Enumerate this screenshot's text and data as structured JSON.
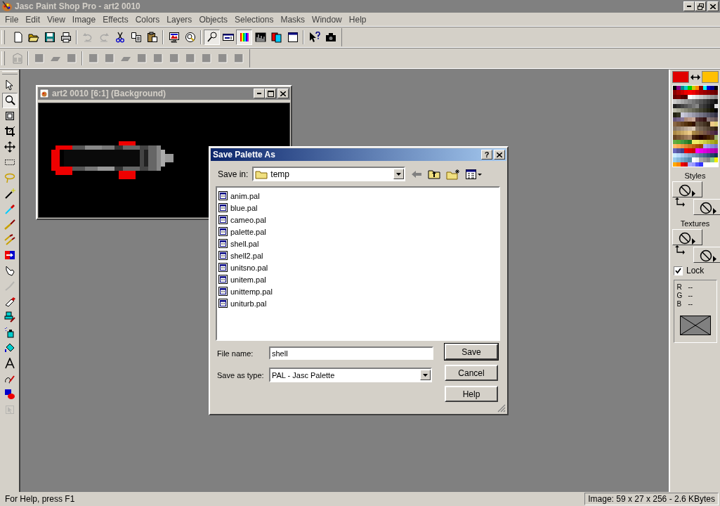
{
  "window": {
    "title": "Jasc Paint Shop Pro - art2 0010"
  },
  "menu": [
    "File",
    "Edit",
    "View",
    "Image",
    "Effects",
    "Colors",
    "Layers",
    "Objects",
    "Selections",
    "Masks",
    "Window",
    "Help"
  ],
  "toolbar_standard": [
    {
      "kind": "new",
      "pressed": false,
      "disabled": false
    },
    {
      "kind": "open",
      "pressed": false,
      "disabled": false
    },
    {
      "kind": "save",
      "pressed": false,
      "disabled": false
    },
    {
      "kind": "print",
      "pressed": false,
      "disabled": false
    },
    {
      "kind": "sep"
    },
    {
      "kind": "undo",
      "pressed": false,
      "disabled": true
    },
    {
      "kind": "redo",
      "pressed": false,
      "disabled": true
    },
    {
      "kind": "cut",
      "pressed": false,
      "disabled": false
    },
    {
      "kind": "copy",
      "pressed": false,
      "disabled": false
    },
    {
      "kind": "paste",
      "pressed": false,
      "disabled": false
    },
    {
      "kind": "sep"
    },
    {
      "kind": "monitor",
      "pressed": false,
      "disabled": false
    },
    {
      "kind": "browse",
      "pressed": false,
      "disabled": false
    },
    {
      "kind": "sep"
    },
    {
      "kind": "overview",
      "pressed": true,
      "disabled": false
    },
    {
      "kind": "options",
      "pressed": false,
      "disabled": false
    },
    {
      "kind": "colors",
      "pressed": true,
      "disabled": false
    },
    {
      "kind": "histogram",
      "pressed": false,
      "disabled": false
    },
    {
      "kind": "layers",
      "pressed": false,
      "disabled": false
    },
    {
      "kind": "panel",
      "pressed": false,
      "disabled": false
    },
    {
      "kind": "sep"
    },
    {
      "kind": "help",
      "pressed": false,
      "disabled": false
    },
    {
      "kind": "scanner",
      "pressed": false,
      "disabled": false
    }
  ],
  "toolbar_effects": [
    {
      "kind": "building",
      "pressed": false,
      "disabled": true
    },
    {
      "kind": "sep"
    },
    {
      "kind": "square",
      "pressed": false,
      "disabled": true
    },
    {
      "kind": "slant",
      "pressed": false,
      "disabled": true
    },
    {
      "kind": "square",
      "pressed": false,
      "disabled": true
    },
    {
      "kind": "sep"
    },
    {
      "kind": "square",
      "pressed": false,
      "disabled": true
    },
    {
      "kind": "square",
      "pressed": false,
      "disabled": true
    },
    {
      "kind": "slant",
      "pressed": false,
      "disabled": true
    },
    {
      "kind": "square",
      "pressed": false,
      "disabled": true
    },
    {
      "kind": "square",
      "pressed": false,
      "disabled": true
    },
    {
      "kind": "square",
      "pressed": false,
      "disabled": true
    },
    {
      "kind": "square",
      "pressed": false,
      "disabled": true
    },
    {
      "kind": "square",
      "pressed": false,
      "disabled": true
    },
    {
      "kind": "square",
      "pressed": false,
      "disabled": true
    },
    {
      "kind": "square",
      "pressed": false,
      "disabled": true
    }
  ],
  "tools": [
    {
      "kind": "arrow",
      "selected": false,
      "disabled": false
    },
    {
      "kind": "zoom",
      "selected": true,
      "disabled": false
    },
    {
      "kind": "deform",
      "selected": false,
      "disabled": false
    },
    {
      "kind": "crop",
      "selected": false,
      "disabled": false
    },
    {
      "kind": "move",
      "selected": false,
      "disabled": false
    },
    {
      "kind": "select",
      "selected": false,
      "disabled": false
    },
    {
      "kind": "lasso",
      "selected": false,
      "disabled": false
    },
    {
      "kind": "wand",
      "selected": false,
      "disabled": false
    },
    {
      "kind": "dropper",
      "selected": false,
      "disabled": false
    },
    {
      "kind": "brush",
      "selected": false,
      "disabled": false
    },
    {
      "kind": "clone",
      "selected": false,
      "disabled": false
    },
    {
      "kind": "replace",
      "selected": false,
      "disabled": false
    },
    {
      "kind": "retouch",
      "selected": false,
      "disabled": false
    },
    {
      "kind": "scratch",
      "selected": false,
      "disabled": true
    },
    {
      "kind": "eraser",
      "selected": false,
      "disabled": false
    },
    {
      "kind": "tube",
      "selected": false,
      "disabled": false
    },
    {
      "kind": "airbrush",
      "selected": false,
      "disabled": false
    },
    {
      "kind": "fill",
      "selected": false,
      "disabled": false
    },
    {
      "kind": "text",
      "selected": false,
      "disabled": false
    },
    {
      "kind": "draw",
      "selected": false,
      "disabled": false
    },
    {
      "kind": "shapes",
      "selected": false,
      "disabled": false
    },
    {
      "kind": "objsel",
      "selected": false,
      "disabled": true
    }
  ],
  "image_window": {
    "title": "art2 0010 [6:1] (Background)"
  },
  "dialog": {
    "title": "Save Palette As",
    "help_button": "?",
    "save_in_label": "Save in:",
    "save_in": "temp",
    "files": [
      "anim.pal",
      "blue.pal",
      "cameo.pal",
      "palette.pal",
      "shell.pal",
      "shell2.pal",
      "unitsno.pal",
      "unitem.pal",
      "unittemp.pal",
      "uniturb.pal"
    ],
    "file_name_label": "File name:",
    "file_name": "shell",
    "type_label": "Save as type:",
    "type": "PAL - Jasc Palette",
    "buttons": [
      {
        "label": "Save",
        "default": true
      },
      {
        "label": "Cancel",
        "default": false
      },
      {
        "label": "Help",
        "default": false
      }
    ]
  },
  "color_panel": {
    "swatches": [
      {
        "color": "#e00000"
      },
      {
        "color": "#ffc000"
      }
    ],
    "styles_label": "Styles",
    "textures_label": "Textures",
    "lock": {
      "label": "Lock",
      "checked": true
    },
    "rgb": [
      {
        "channel": "R",
        "value": "--"
      },
      {
        "channel": "G",
        "value": "--"
      },
      {
        "channel": "B",
        "value": "--"
      }
    ]
  },
  "status_bar": {
    "help": "For Help, press F1",
    "info": "Image:  59 x 27 x 256 - 2.6 KBytes"
  }
}
